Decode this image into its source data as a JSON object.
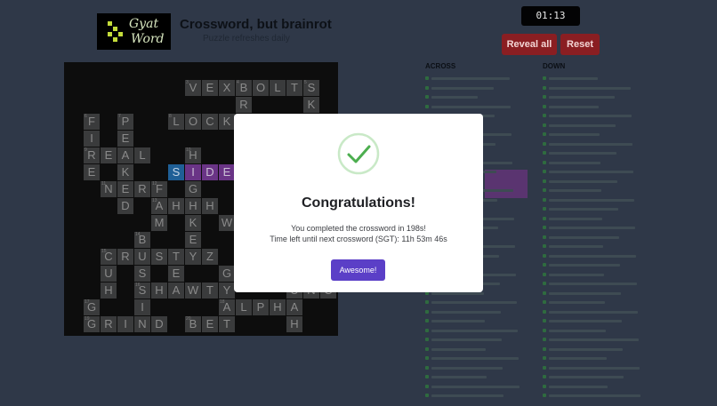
{
  "header": {
    "logo_line1": "Gyat",
    "logo_line2": "Word",
    "title": "Crossword, but brainrot",
    "subtitle": "Puzzle refreshes daily"
  },
  "timer": "01:13",
  "buttons": {
    "reveal": "Reveal all",
    "reset": "Reset"
  },
  "clues": {
    "across_heading": "ACROSS",
    "down_heading": "DOWN"
  },
  "grid_cells": [
    {
      "letter": "V",
      "num": "3"
    },
    {
      "letter": "E"
    },
    {
      "letter": "X"
    },
    {
      "letter": "B",
      "num": "4"
    },
    {
      "letter": "O"
    },
    {
      "letter": "L"
    },
    {
      "letter": "T"
    },
    {
      "letter": "S",
      "num": "5"
    },
    {
      "letter": "R"
    },
    {
      "letter": "K"
    },
    {
      "letter": "F",
      "num": "6"
    },
    {
      "letter": "P",
      "num": "7"
    },
    {
      "letter": "L",
      "num": "8"
    },
    {
      "letter": "O"
    },
    {
      "letter": "C"
    },
    {
      "letter": "K"
    },
    {
      "letter": "I"
    },
    {
      "letter": "E"
    },
    {
      "letter": "R",
      "num": "9"
    },
    {
      "letter": "E"
    },
    {
      "letter": "A"
    },
    {
      "letter": "L"
    },
    {
      "letter": "H",
      "num": "10"
    },
    {
      "letter": "E"
    },
    {
      "letter": "K"
    },
    {
      "letter": "S"
    },
    {
      "letter": "I"
    },
    {
      "letter": "D"
    },
    {
      "letter": "E"
    },
    {
      "letter": "N",
      "num": "11"
    },
    {
      "letter": "E"
    },
    {
      "letter": "R"
    },
    {
      "letter": "F",
      "num": "12"
    },
    {
      "letter": "G"
    },
    {
      "letter": "D"
    },
    {
      "letter": "A",
      "num": "13"
    },
    {
      "letter": "H"
    },
    {
      "letter": "H"
    },
    {
      "letter": "H"
    },
    {
      "letter": "M"
    },
    {
      "letter": "K"
    },
    {
      "letter": "W"
    },
    {
      "letter": "B",
      "num": "14"
    },
    {
      "letter": "E"
    },
    {
      "letter": "C",
      "num": "15"
    },
    {
      "letter": "R"
    },
    {
      "letter": "U"
    },
    {
      "letter": "S"
    },
    {
      "letter": "T"
    },
    {
      "letter": "Y"
    },
    {
      "letter": "Z"
    },
    {
      "letter": "U"
    },
    {
      "letter": "S"
    },
    {
      "letter": "E"
    },
    {
      "letter": "G"
    },
    {
      "letter": "H"
    },
    {
      "letter": "S",
      "num": "16"
    },
    {
      "letter": "H"
    },
    {
      "letter": "A"
    },
    {
      "letter": "W"
    },
    {
      "letter": "T"
    },
    {
      "letter": "Y"
    },
    {
      "letter": "U"
    },
    {
      "letter": "N"
    },
    {
      "letter": "C"
    },
    {
      "letter": "G",
      "num": "17"
    },
    {
      "letter": "I"
    },
    {
      "letter": "A",
      "num": "18"
    },
    {
      "letter": "L"
    },
    {
      "letter": "P"
    },
    {
      "letter": "H"
    },
    {
      "letter": "A"
    },
    {
      "letter": "G",
      "num": "19"
    },
    {
      "letter": "R"
    },
    {
      "letter": "I"
    },
    {
      "letter": "N"
    },
    {
      "letter": "D"
    },
    {
      "letter": "B",
      "num": "20"
    },
    {
      "letter": "E"
    },
    {
      "letter": "T"
    },
    {
      "letter": "H"
    }
  ],
  "modal": {
    "title": "Congratulations!",
    "line1": "You completed the crossword in 198s!",
    "line2": "Time left until next crossword (SGT): 11h 53m 46s",
    "button": "Awesome!"
  },
  "colors": {
    "background": "#2f3848",
    "cell": "#3a3b3c",
    "highlight": "#6a3486",
    "active": "#1f5f96",
    "button_red": "#8a1e22",
    "modal_button": "#5b3fc7",
    "check_green": "#4cae4f"
  },
  "icons": {
    "check": "check-circle-icon"
  }
}
